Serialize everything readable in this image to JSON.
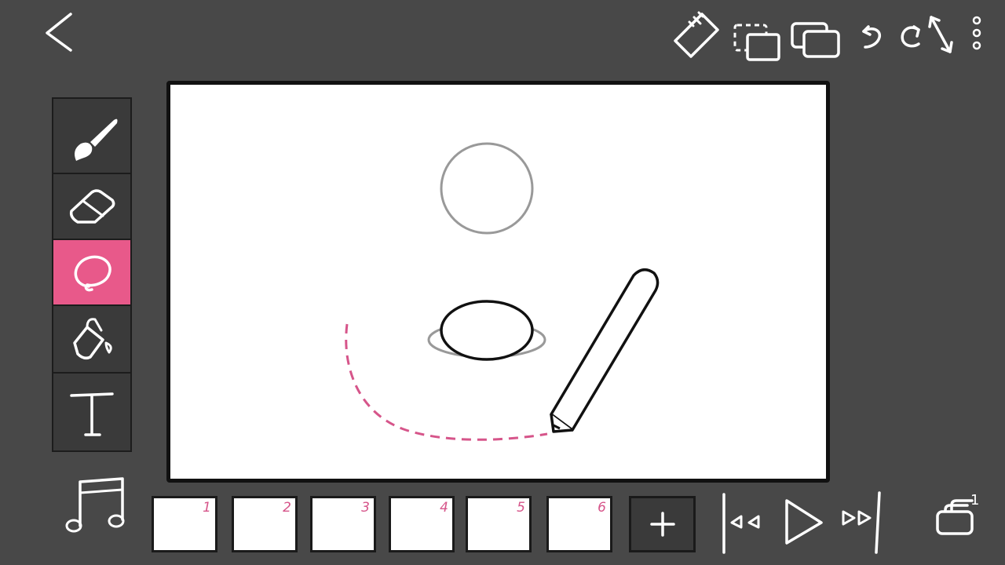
{
  "topbar": {
    "icons": [
      "back-icon",
      "ruler-icon",
      "selection-copy-icon",
      "layers-icon",
      "undo-icon",
      "redo-icon",
      "resize-icon",
      "more-icon"
    ]
  },
  "tools": [
    {
      "name": "brush",
      "icon": "brush-icon",
      "active": false
    },
    {
      "name": "eraser",
      "icon": "eraser-icon",
      "active": false
    },
    {
      "name": "lasso",
      "icon": "lasso-icon",
      "active": true
    },
    {
      "name": "fill",
      "icon": "fill-bucket-icon",
      "active": false
    },
    {
      "name": "text",
      "icon": "text-icon",
      "active": false
    }
  ],
  "colors": {
    "background": "#484848",
    "accent": "#e8598a",
    "frame_number": "#d6558a",
    "canvas": "#ffffff"
  },
  "timeline": {
    "frames": [
      "1",
      "2",
      "3",
      "4",
      "5",
      "6"
    ],
    "add_label": "+",
    "layer_count": "1"
  },
  "playback": {
    "icons": [
      "skip-start-icon",
      "play-icon",
      "skip-end-icon"
    ]
  }
}
